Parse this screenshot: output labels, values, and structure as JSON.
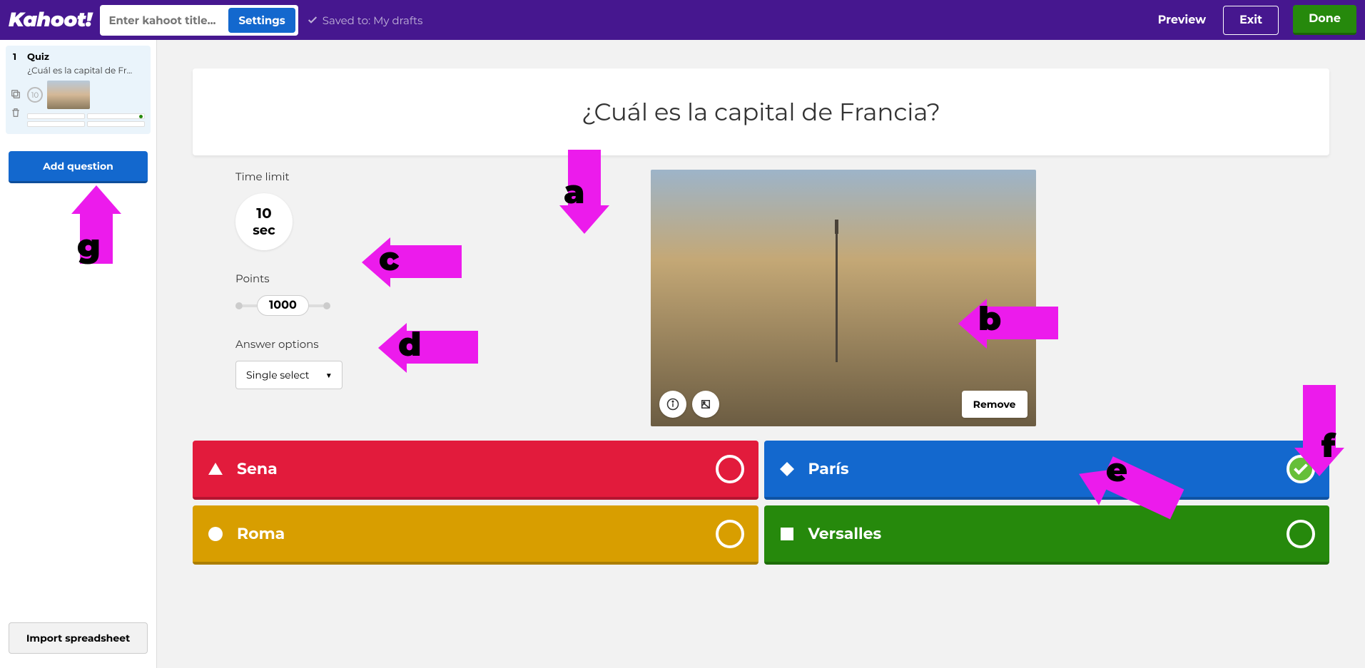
{
  "topbar": {
    "logo": "Kahoot!",
    "title_placeholder": "Enter kahoot title...",
    "settings": "Settings",
    "saved_to": "Saved to: My drafts",
    "preview": "Preview",
    "exit": "Exit",
    "done": "Done"
  },
  "sidebar": {
    "slides": [
      {
        "num": "1",
        "type": "Quiz",
        "question": "¿Cuál es la capital de Fr...",
        "time": "10"
      }
    ],
    "add_question": "Add question",
    "import": "Import spreadsheet"
  },
  "editor": {
    "question": "¿Cuál es la capital de Francia?",
    "time_label": "Time limit",
    "time_value": "10",
    "time_unit": "sec",
    "points_label": "Points",
    "points_value": "1000",
    "answer_options_label": "Answer options",
    "answer_options_value": "Single select",
    "image_remove": "Remove",
    "answers": [
      {
        "text": "Sena",
        "correct": false,
        "color": "red",
        "shape": "triangle"
      },
      {
        "text": "París",
        "correct": true,
        "color": "blue",
        "shape": "diamond"
      },
      {
        "text": "Roma",
        "correct": false,
        "color": "yellow",
        "shape": "circle"
      },
      {
        "text": "Versalles",
        "correct": false,
        "color": "green",
        "shape": "square"
      }
    ]
  },
  "annotations": {
    "a": "a",
    "b": "b",
    "c": "c",
    "d": "d",
    "e": "e",
    "f": "f",
    "g": "g"
  }
}
